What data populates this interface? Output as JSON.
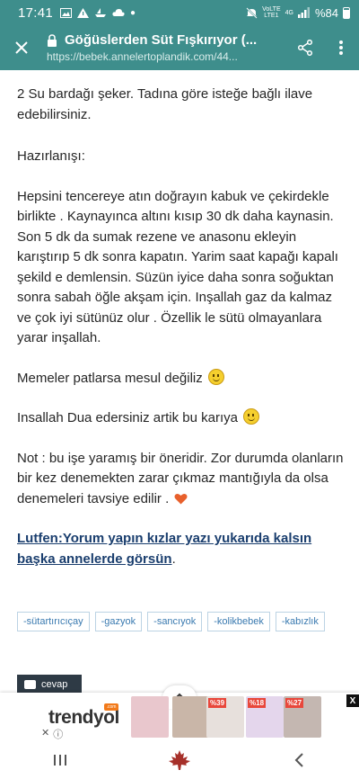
{
  "status_bar": {
    "time": "17:41",
    "left_icons": [
      "image-icon",
      "alert-icon",
      "boat-icon",
      "cloud-icon",
      "dot-icon"
    ],
    "network_top": "VoLTE",
    "network_bottom": "LTE1",
    "network_type": "4G",
    "battery": "%84"
  },
  "toolbar": {
    "close_icon": "close-icon",
    "title": "Göğüslerden Süt Fışkırıyor (...",
    "url": "https://bebek.annelertoplandik.com/44...",
    "share_icon": "share-icon",
    "menu_icon": "more-vert-icon"
  },
  "post": {
    "line_ingredient": "2 Su bardağı şeker.  Tadına göre isteğe bağlı ilave edebilirsiniz.",
    "heading_preparation": "Hazırlanışı:",
    "preparation": "Hepsini tencereye atın doğrayın kabuk ve çekirdekle birlikte . Kaynayınca altını kısıp 30 dk daha kaynasin. Son 5 dk da sumak rezene ve anasonu ekleyin karıştırıp 5 dk sonra kapatın.  Yarim saat kapağı kapalı şekild e demlensin.  Süzün iyice daha sonra soğuktan sonra sabah öğle akşam için.  Inşallah gaz da kalmaz ve çok iyi sütünüz olur . Özellik le sütü olmayanlara yarar inşallah.",
    "memeler": "Memeler patlarsa mesul değiliz",
    "dua": "Insallah Dua edersiniz artik bu karıya",
    "note": "Not : bu işe yaramış bir öneridir.  Zor durumda olanların bir kez denemekten zarar çıkmaz mantığıyla da olsa denemeleri tavsiye edilir .",
    "cta_link": "Lutfen:Yorum yapın kızlar yazı yukarıda kalsın başka annelerde görsün",
    "cta_suffix": "."
  },
  "tags": [
    "-sütartırıcıçay",
    "-gazyok",
    "-sancıyok",
    "-kolikbebek",
    "-kabızlık"
  ],
  "reply_button": {
    "label": "cevap",
    "icon": "chat-bubble-icon"
  },
  "ad": {
    "brand": "trendyol",
    "brand_badge": ".com",
    "collapse_icon": "chevron-up-icon",
    "close_label": "X",
    "discounts": [
      "%39",
      "%18",
      "%27"
    ],
    "colors": {
      "brand_orange": "#f27a1a",
      "discount_red": "#e8473b"
    }
  },
  "nav_bar": {
    "recents_icon": "recents-icon",
    "home_icon": "maple-leaf-icon",
    "back_icon": "back-icon"
  },
  "colors": {
    "toolbar": "#3e8e8c",
    "link": "#1a3e6e",
    "tag_text": "#3a7ab0",
    "reply_button": "#2e3a45"
  }
}
